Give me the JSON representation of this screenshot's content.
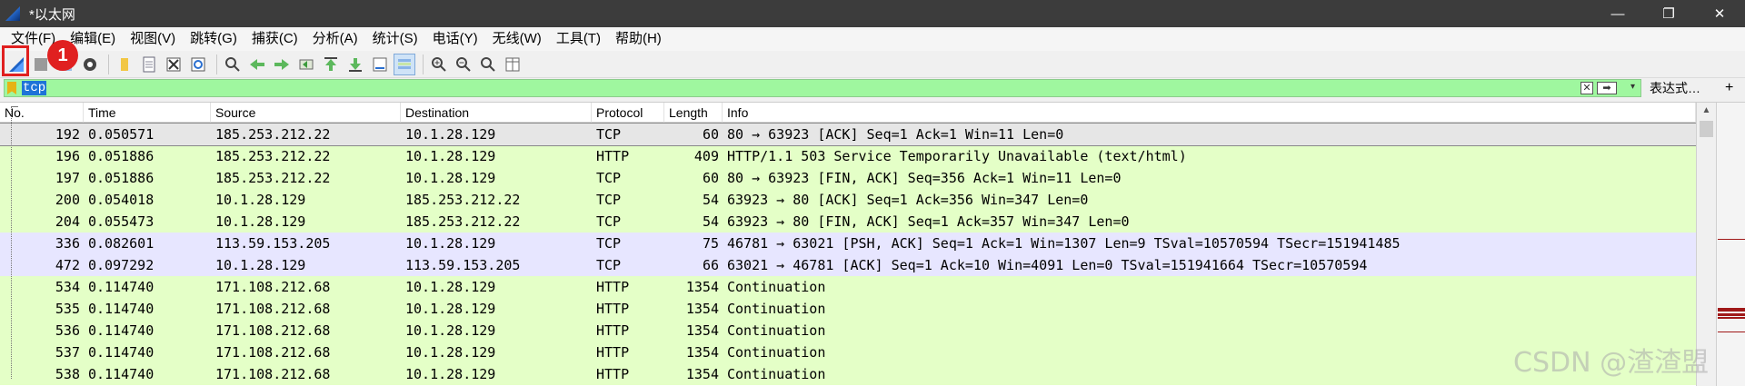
{
  "window": {
    "title": "*以太网",
    "controls": {
      "minimize": "—",
      "maximize": "❐",
      "close": "✕"
    }
  },
  "menu": {
    "items": [
      "文件(F)",
      "编辑(E)",
      "视图(V)",
      "跳转(G)",
      "捕获(C)",
      "分析(A)",
      "统计(S)",
      "电话(Y)",
      "无线(W)",
      "工具(T)",
      "帮助(H)"
    ]
  },
  "annotation": {
    "badge": "1"
  },
  "filter": {
    "value": "tcp",
    "clear_icon": "✕",
    "apply_icon": "➡",
    "dropdown_icon": "▾",
    "expression_label": "表达式…",
    "add_label": "+"
  },
  "columns": {
    "no": "No.",
    "time": "Time",
    "source": "Source",
    "destination": "Destination",
    "protocol": "Protocol",
    "length": "Length",
    "info": "Info"
  },
  "packets": [
    {
      "no": "192",
      "time": "0.050571",
      "source": "185.253.212.22",
      "destination": "10.1.28.129",
      "protocol": "TCP",
      "length": "60",
      "info": "80 → 63923 [ACK] Seq=1 Ack=1 Win=11 Len=0",
      "bg": "#e6e6e6",
      "selected": true
    },
    {
      "no": "196",
      "time": "0.051886",
      "source": "185.253.212.22",
      "destination": "10.1.28.129",
      "protocol": "HTTP",
      "length": "409",
      "info": "HTTP/1.1 503 Service Temporarily Unavailable  (text/html)",
      "bg": "#e4ffc7"
    },
    {
      "no": "197",
      "time": "0.051886",
      "source": "185.253.212.22",
      "destination": "10.1.28.129",
      "protocol": "TCP",
      "length": "60",
      "info": "80 → 63923 [FIN, ACK] Seq=356 Ack=1 Win=11 Len=0",
      "bg": "#e4ffc7"
    },
    {
      "no": "200",
      "time": "0.054018",
      "source": "10.1.28.129",
      "destination": "185.253.212.22",
      "protocol": "TCP",
      "length": "54",
      "info": "63923 → 80 [ACK] Seq=1 Ack=356 Win=347 Len=0",
      "bg": "#e4ffc7"
    },
    {
      "no": "204",
      "time": "0.055473",
      "source": "10.1.28.129",
      "destination": "185.253.212.22",
      "protocol": "TCP",
      "length": "54",
      "info": "63923 → 80 [FIN, ACK] Seq=1 Ack=357 Win=347 Len=0",
      "bg": "#e4ffc7"
    },
    {
      "no": "336",
      "time": "0.082601",
      "source": "113.59.153.205",
      "destination": "10.1.28.129",
      "protocol": "TCP",
      "length": "75",
      "info": "46781 → 63021 [PSH, ACK] Seq=1 Ack=1 Win=1307 Len=9 TSval=10570594 TSecr=151941485",
      "bg": "#e7e6ff"
    },
    {
      "no": "472",
      "time": "0.097292",
      "source": "10.1.28.129",
      "destination": "113.59.153.205",
      "protocol": "TCP",
      "length": "66",
      "info": "63021 → 46781 [ACK] Seq=1 Ack=10 Win=4091 Len=0 TSval=151941664 TSecr=10570594",
      "bg": "#e7e6ff"
    },
    {
      "no": "534",
      "time": "0.114740",
      "source": "171.108.212.68",
      "destination": "10.1.28.129",
      "protocol": "HTTP",
      "length": "1354",
      "info": "Continuation",
      "bg": "#e4ffc7"
    },
    {
      "no": "535",
      "time": "0.114740",
      "source": "171.108.212.68",
      "destination": "10.1.28.129",
      "protocol": "HTTP",
      "length": "1354",
      "info": "Continuation",
      "bg": "#e4ffc7"
    },
    {
      "no": "536",
      "time": "0.114740",
      "source": "171.108.212.68",
      "destination": "10.1.28.129",
      "protocol": "HTTP",
      "length": "1354",
      "info": "Continuation",
      "bg": "#e4ffc7"
    },
    {
      "no": "537",
      "time": "0.114740",
      "source": "171.108.212.68",
      "destination": "10.1.28.129",
      "protocol": "HTTP",
      "length": "1354",
      "info": "Continuation",
      "bg": "#e4ffc7"
    },
    {
      "no": "538",
      "time": "0.114740",
      "source": "171.108.212.68",
      "destination": "10.1.28.129",
      "protocol": "HTTP",
      "length": "1354",
      "info": "Continuation",
      "bg": "#e4ffc7"
    }
  ],
  "watermark": "CSDN @渣渣盟",
  "colors": {
    "accent_red": "#e02020",
    "tcp_green": "#e4ffc7",
    "tcp_purple": "#e7e6ff",
    "selected_gray": "#e6e6e6",
    "filter_valid": "#9ff79f"
  }
}
